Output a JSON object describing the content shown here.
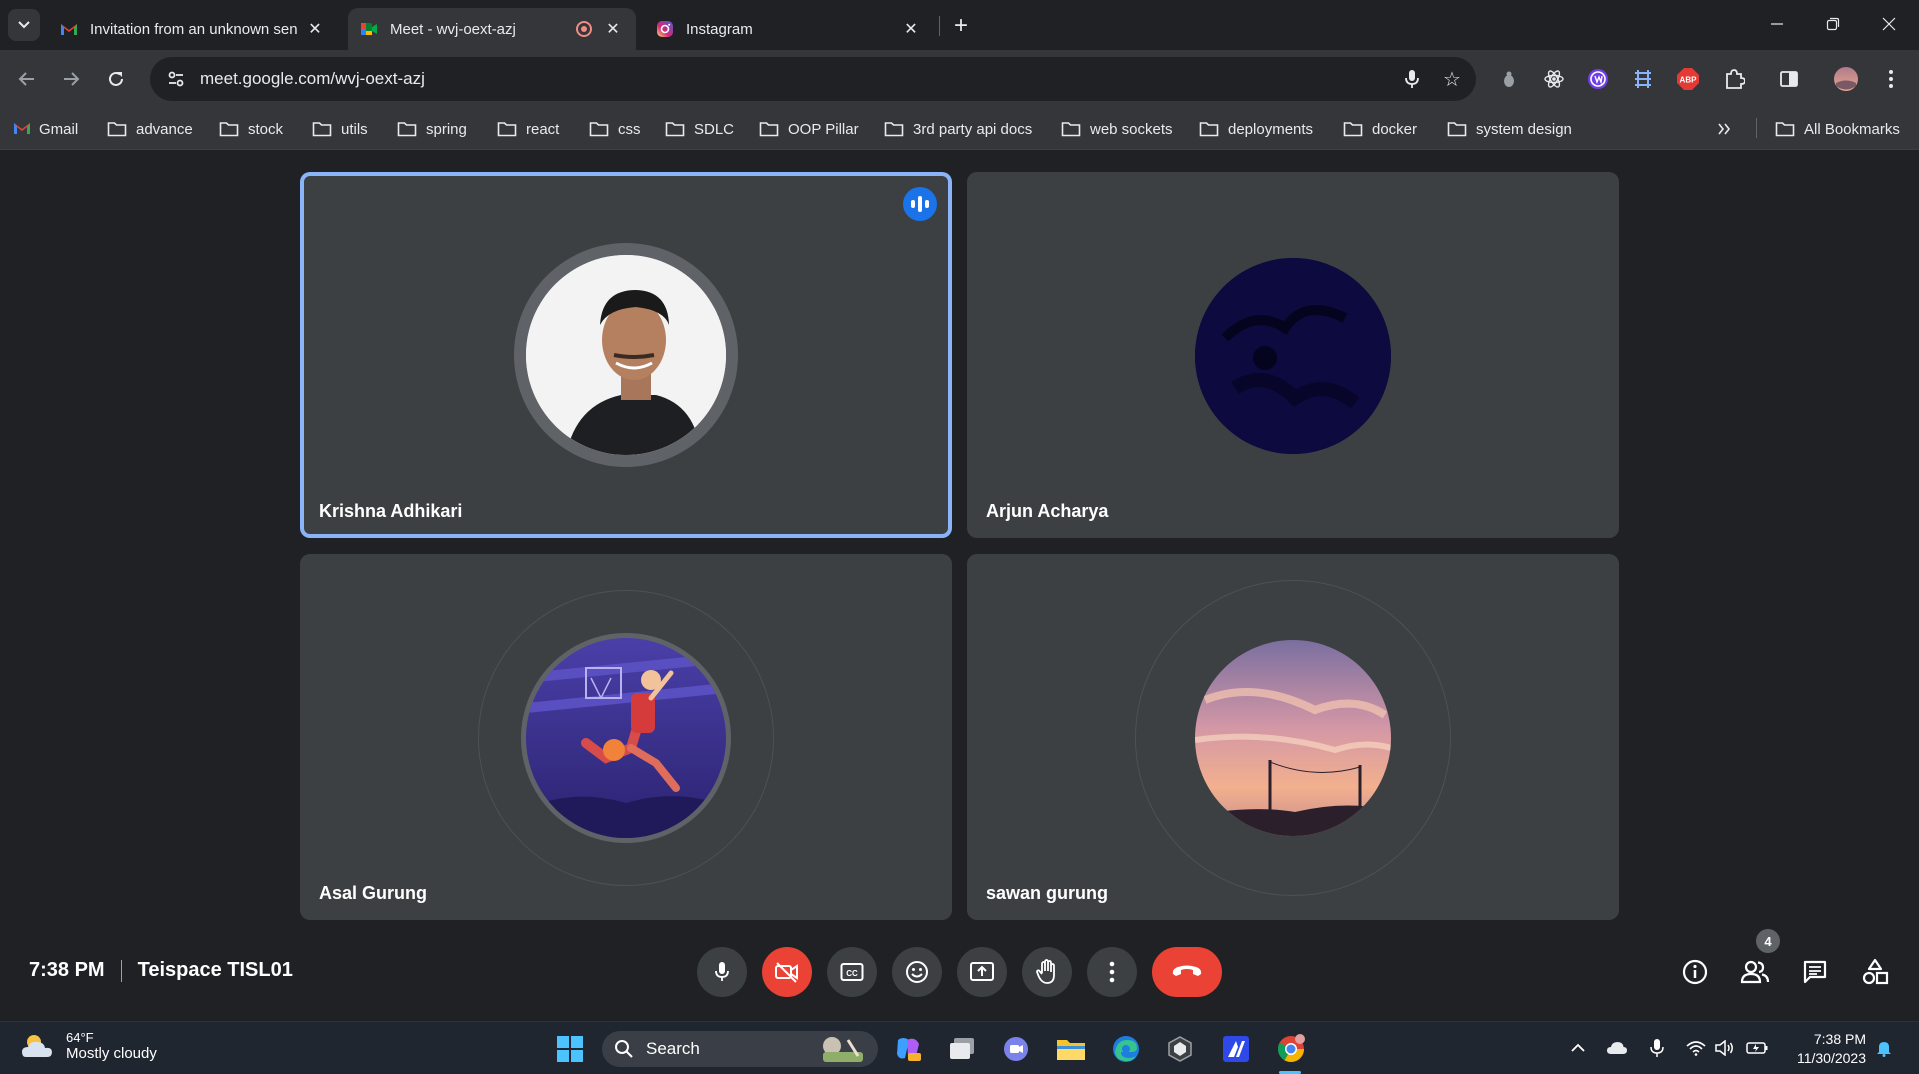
{
  "browser": {
    "tabs": [
      {
        "title": "Invitation from an unknown sen",
        "favicon": "gmail-icon",
        "active": false
      },
      {
        "title": "Meet - wvj-oext-azj",
        "favicon": "meet-icon",
        "active": true,
        "recording": true
      },
      {
        "title": "Instagram",
        "favicon": "instagram-icon",
        "active": false
      }
    ],
    "url": "meet.google.com/wvj-oext-azj",
    "bookmarks": [
      {
        "label": "Gmail",
        "icon": "gmail-icon"
      },
      {
        "label": "advance",
        "icon": "folder-icon"
      },
      {
        "label": "stock",
        "icon": "folder-icon"
      },
      {
        "label": "utils",
        "icon": "folder-icon"
      },
      {
        "label": "spring",
        "icon": "folder-icon"
      },
      {
        "label": "react",
        "icon": "folder-icon"
      },
      {
        "label": "css",
        "icon": "folder-icon"
      },
      {
        "label": "SDLC",
        "icon": "folder-icon"
      },
      {
        "label": "OOP Pillar",
        "icon": "folder-icon"
      },
      {
        "label": "3rd party api docs",
        "icon": "folder-icon"
      },
      {
        "label": "web sockets",
        "icon": "folder-icon"
      },
      {
        "label": "deployments",
        "icon": "folder-icon"
      },
      {
        "label": "docker",
        "icon": "folder-icon"
      },
      {
        "label": "system design",
        "icon": "folder-icon"
      }
    ],
    "all_bookmarks_label": "All Bookmarks",
    "extensions": [
      "profile-dot-icon",
      "react-devtools-icon",
      "extension-purple-icon",
      "grid-extension-icon",
      "adblock-icon",
      "puzzle-icon",
      "sidepanel-icon",
      "profile-avatar"
    ]
  },
  "meet": {
    "participants": [
      {
        "name": "Krishna Adhikari",
        "speaking": true
      },
      {
        "name": "Arjun Acharya",
        "speaking": false
      },
      {
        "name": "Asal Gurung",
        "speaking": false
      },
      {
        "name": "sawan gurung",
        "speaking": false
      }
    ],
    "time": "7:38 PM",
    "meeting_name": "Teispace TISL01",
    "participant_count": "4",
    "colors": {
      "accent": "#8ab4f8",
      "danger": "#ea4335",
      "tile": "#3c4043",
      "background": "#202124"
    }
  },
  "taskbar": {
    "weather_temp": "64°F",
    "weather_desc": "Mostly cloudy",
    "search_label": "Search",
    "time": "7:38 PM",
    "date": "11/30/2023"
  }
}
